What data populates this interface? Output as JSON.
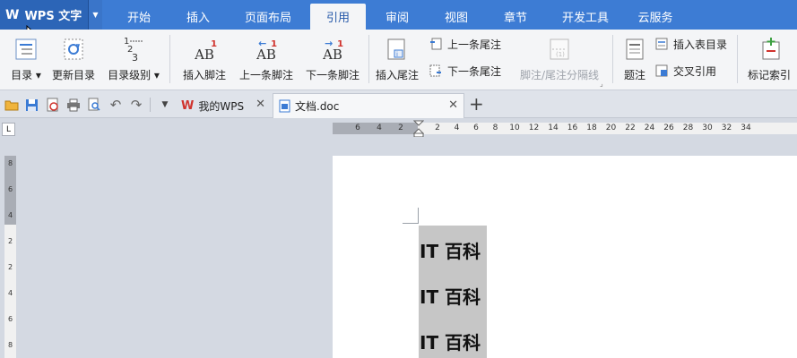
{
  "app": {
    "name": "WPS 文字"
  },
  "menu": {
    "tabs": [
      "开始",
      "插入",
      "页面布局",
      "引用",
      "审阅",
      "视图",
      "章节",
      "开发工具",
      "云服务"
    ],
    "active": "引用"
  },
  "ribbon": {
    "toc": "目录",
    "update_toc": "更新目录",
    "toc_level": "目录级别",
    "insert_footnote": "插入脚注",
    "prev_footnote": "上一条脚注",
    "next_footnote": "下一条脚注",
    "insert_endnote": "插入尾注",
    "prev_endnote": "上一条尾注",
    "next_endnote": "下一条尾注",
    "footnote_separator": "脚注/尾注分隔线",
    "caption": "题注",
    "insert_table_of_figures": "插入表目录",
    "cross_reference": "交叉引用",
    "mark_index": "标记索引"
  },
  "doc_tabs": [
    {
      "label": "我的WPS"
    },
    {
      "label": "文档.doc"
    }
  ],
  "ruler": {
    "h_numbers": [
      "6",
      "4",
      "2",
      "2",
      "4",
      "6",
      "8",
      "10",
      "12",
      "14",
      "16",
      "18",
      "20",
      "22",
      "24",
      "26",
      "28",
      "30",
      "32",
      "34"
    ],
    "v_numbers": [
      "8",
      "6",
      "4",
      "2",
      "2",
      "4",
      "6",
      "8"
    ]
  },
  "document": {
    "lines": [
      "IT 百科",
      "IT 百科",
      "IT 百科"
    ]
  },
  "colors": {
    "menu_bg": "#3d7cd4",
    "app_button_bg": "#2c65b7",
    "ribbon_bg": "#f4f5f7",
    "selection": "#c6c6c6",
    "accent_red": "#d0332d"
  }
}
